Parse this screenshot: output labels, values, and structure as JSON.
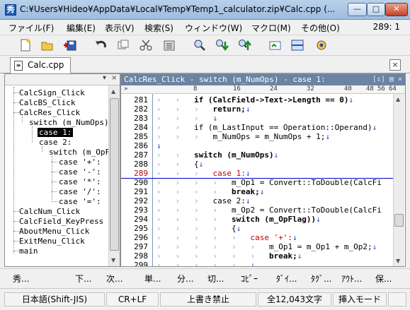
{
  "window": {
    "title": "C:¥Users¥Hideo¥AppData¥Local¥Temp¥Temp1_calculator.zip¥Calc.cpp (...",
    "min_glyph": "—",
    "max_glyph": "□",
    "close_glyph": "✕"
  },
  "menu": {
    "items": [
      "ファイル(F)",
      "編集(E)",
      "表示(V)",
      "検索(S)",
      "ウィンドウ(W)",
      "マクロ(M)",
      "その他(O)"
    ],
    "cursor_position": "289: 1"
  },
  "toolbar": {
    "buttons": [
      "new-file-icon",
      "open-folder-icon",
      "save-icon",
      "undo-icon",
      "copy-icon",
      "cut-icon",
      "paste-icon",
      "find-icon",
      "find-next-icon",
      "find-prev-icon",
      "jump-icon",
      "split-window-icon",
      "settings-icon"
    ]
  },
  "tabs": [
    {
      "label": "Calc.cpp",
      "active": true
    }
  ],
  "outline": {
    "items": [
      {
        "label": "CalcSign_Click"
      },
      {
        "label": "CalcBS_Click"
      },
      {
        "label": "CalcRes_Click"
      },
      {
        "label": "switch (m_NumOps)"
      },
      {
        "label": "case 1:",
        "selected": true
      },
      {
        "label": "case 2:"
      },
      {
        "label": "switch (m_OpF"
      },
      {
        "label": "case '+':"
      },
      {
        "label": "case '-':"
      },
      {
        "label": "case '*':"
      },
      {
        "label": "case '/':"
      },
      {
        "label": "case '=':"
      },
      {
        "label": "CalcNum_Click"
      },
      {
        "label": "CalcField_KeyPress"
      },
      {
        "label": "AboutMenu_Click"
      },
      {
        "label": "ExitMenu_Click"
      },
      {
        "label": "main"
      }
    ]
  },
  "editor": {
    "header": "CalcRes_Click - switch (m_NumOps) - case 1:",
    "ruler_marks": [
      "»",
      "8",
      "16",
      "24",
      "32",
      "40",
      "48",
      "56",
      "64"
    ],
    "current_line": "289",
    "lines": [
      {
        "num": "281",
        "text": "if (CalcField->Text->Length == 0)"
      },
      {
        "num": "282",
        "text": "return;"
      },
      {
        "num": "283",
        "text": ""
      },
      {
        "num": "284",
        "text": "if (m_LastInput == Operation::Operand)"
      },
      {
        "num": "285",
        "text": "m_NumOps = m_NumOps + 1;"
      },
      {
        "num": "286",
        "text": ""
      },
      {
        "num": "287",
        "text": "switch (m_NumOps)"
      },
      {
        "num": "288",
        "text": "{"
      },
      {
        "num": "289",
        "text": "case 1:"
      },
      {
        "num": "290",
        "text": "m_Op1 = Convert::ToDouble(CalcFi"
      },
      {
        "num": "291",
        "text": "break;"
      },
      {
        "num": "292",
        "text": "case 2:"
      },
      {
        "num": "293",
        "text": "m_Op2 = Convert::ToDouble(CalcFi"
      },
      {
        "num": "294",
        "text": "switch (m_OpFlag))"
      },
      {
        "num": "295",
        "text": "{"
      },
      {
        "num": "296",
        "text": "case '+':"
      },
      {
        "num": "297",
        "text": "m_Op1 = m_Op1 + m_Op2;"
      },
      {
        "num": "298",
        "text": "break;"
      },
      {
        "num": "299",
        "text": ""
      }
    ]
  },
  "function_keys": [
    "秀...",
    "下...",
    "次...",
    "単...",
    "分...",
    "切...",
    "ｺﾋﾟｰ",
    "ﾀﾞｲ...",
    "ﾀｸﾞ...",
    "ｱｳﾄ...",
    "保..."
  ],
  "status": {
    "encoding": "日本語(Shift-JIS)",
    "line_ending": "CR+LF",
    "overwrite": "上書き禁止",
    "char_count": "全12,043文字",
    "mode": "挿入モード"
  },
  "colors": {
    "title_gradient_top": "#b9d1ea",
    "editor_header": "#6b84a3",
    "keyword_current": "#c00000",
    "line_end_marker": "#1a4fd0"
  }
}
